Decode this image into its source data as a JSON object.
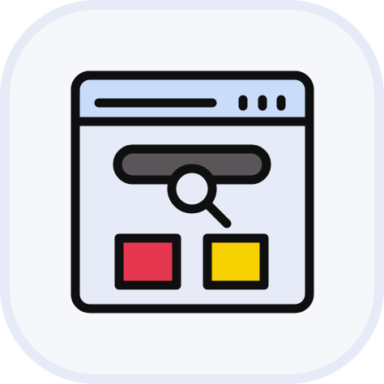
{
  "icon": {
    "name": "browser-search-icon",
    "tile_color": "#f6f7fb",
    "tile_border_color": "#e6ebf7",
    "window_fill": "#e6ebf7",
    "titlebar_fill": "#c9ddfb",
    "outline_color": "#0f0f0f",
    "search_bar_color": "#5a5558",
    "red_block_color": "#e5374f",
    "yellow_block_color": "#f7d200"
  }
}
